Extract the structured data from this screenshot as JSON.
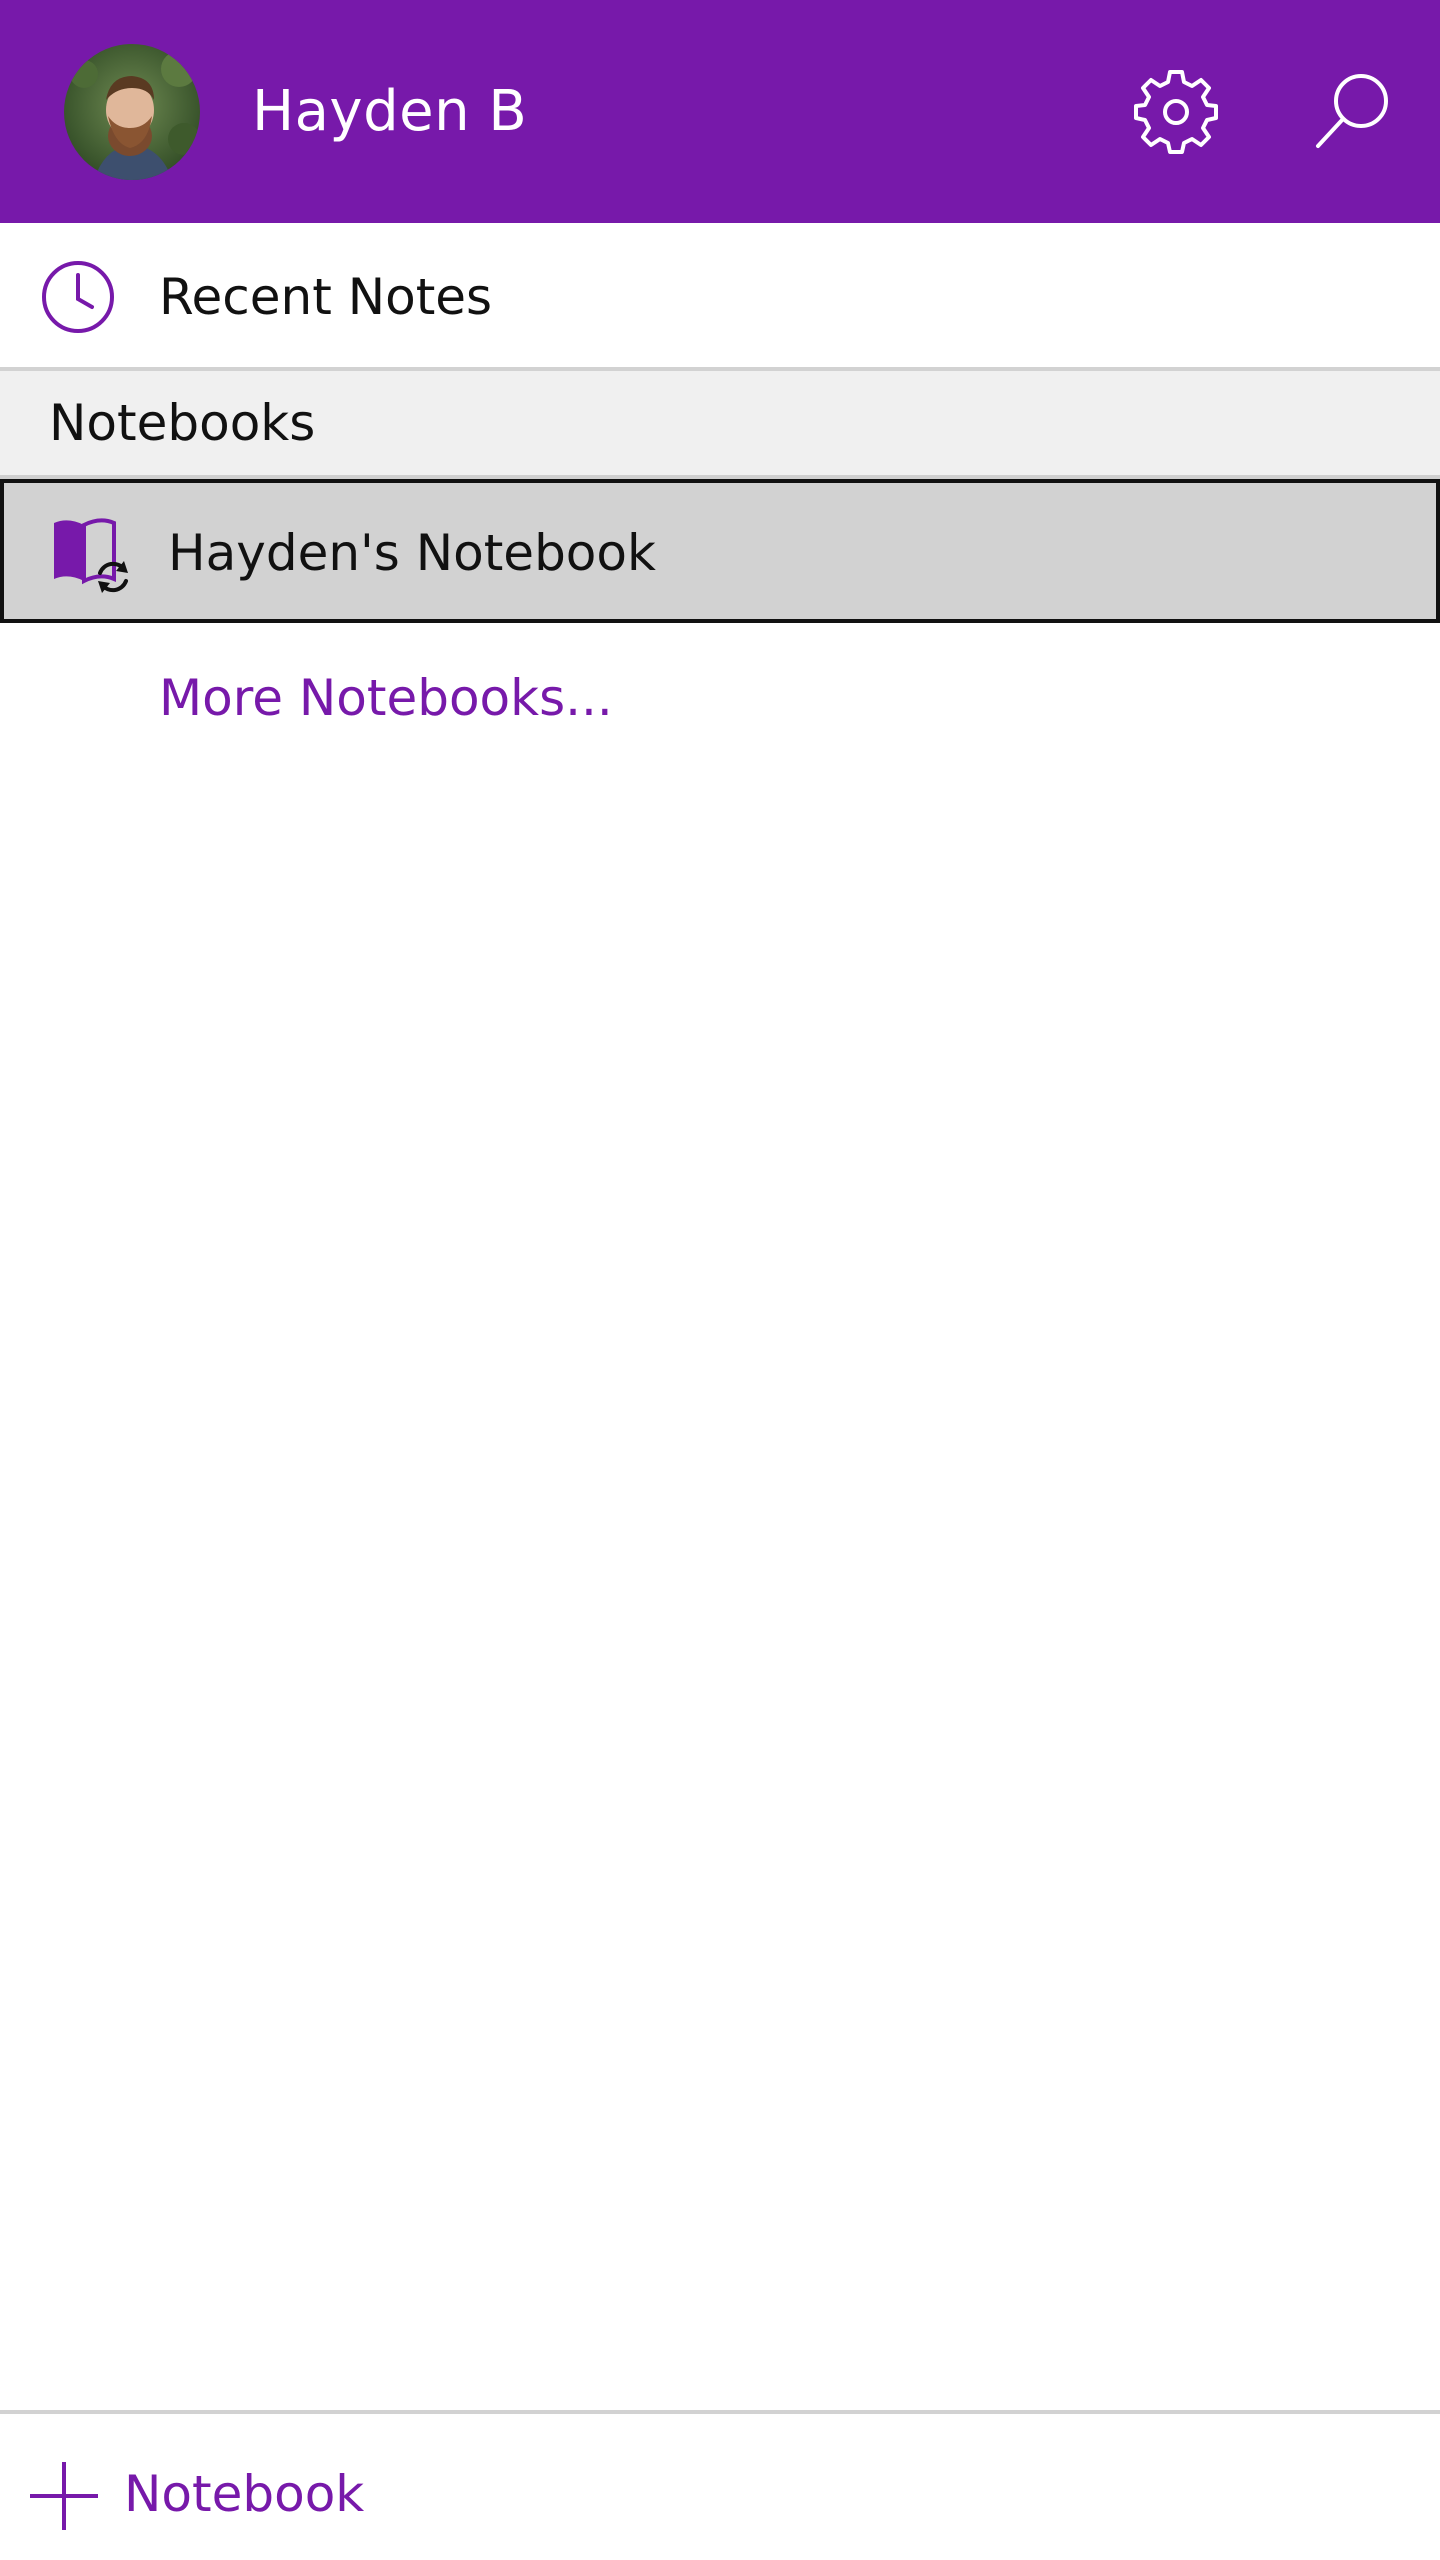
{
  "header": {
    "user_name": "Hayden B",
    "background_color": "#7719aa",
    "avatar_icon": "user-avatar-photo",
    "settings_icon": "gear-icon",
    "search_icon": "search-icon"
  },
  "recent": {
    "label": "Recent Notes",
    "icon": "clock-icon"
  },
  "notebooks_section": {
    "label": "Notebooks",
    "items": [
      {
        "label": "Hayden's Notebook",
        "icon": "notebook-sync-icon",
        "selected": true
      }
    ],
    "more_link": "More Notebooks..."
  },
  "footer": {
    "add_label": "Notebook",
    "add_icon": "plus-icon",
    "accent_color": "#7719aa"
  }
}
